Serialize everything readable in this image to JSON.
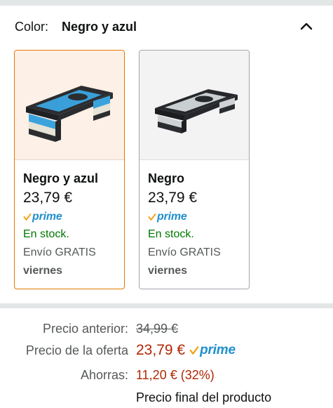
{
  "color_selector": {
    "label": "Color:",
    "selected_value": "Negro y azul",
    "collapse_icon": "chevron-up-icon"
  },
  "swatches": [
    {
      "name": "Negro y azul",
      "price": "23,79 €",
      "prime": "prime",
      "stock": "En stock.",
      "shipping": "Envío GRATIS",
      "delivery_day": "viernes",
      "selected": true,
      "image": "aerobic-step-black-blue"
    },
    {
      "name": "Negro",
      "price": "23,79 €",
      "prime": "prime",
      "stock": "En stock.",
      "shipping": "Envío GRATIS",
      "delivery_day": "viernes",
      "selected": false,
      "image": "aerobic-step-black-grey"
    }
  ],
  "pricing": {
    "previous_label": "Precio anterior:",
    "previous_value": "34,99 €",
    "deal_label": "Precio de la oferta",
    "deal_value": "23,79 €",
    "deal_prime": "prime",
    "savings_label": "Ahorras:",
    "savings_value": "11,20 € (32%)",
    "final_note": "Precio final del producto"
  },
  "colors": {
    "selected_border": "#e77600",
    "in_stock": "#007600",
    "price_red": "#b12704",
    "prime_blue": "#1f8fce",
    "prime_check": "#f0a51d"
  }
}
